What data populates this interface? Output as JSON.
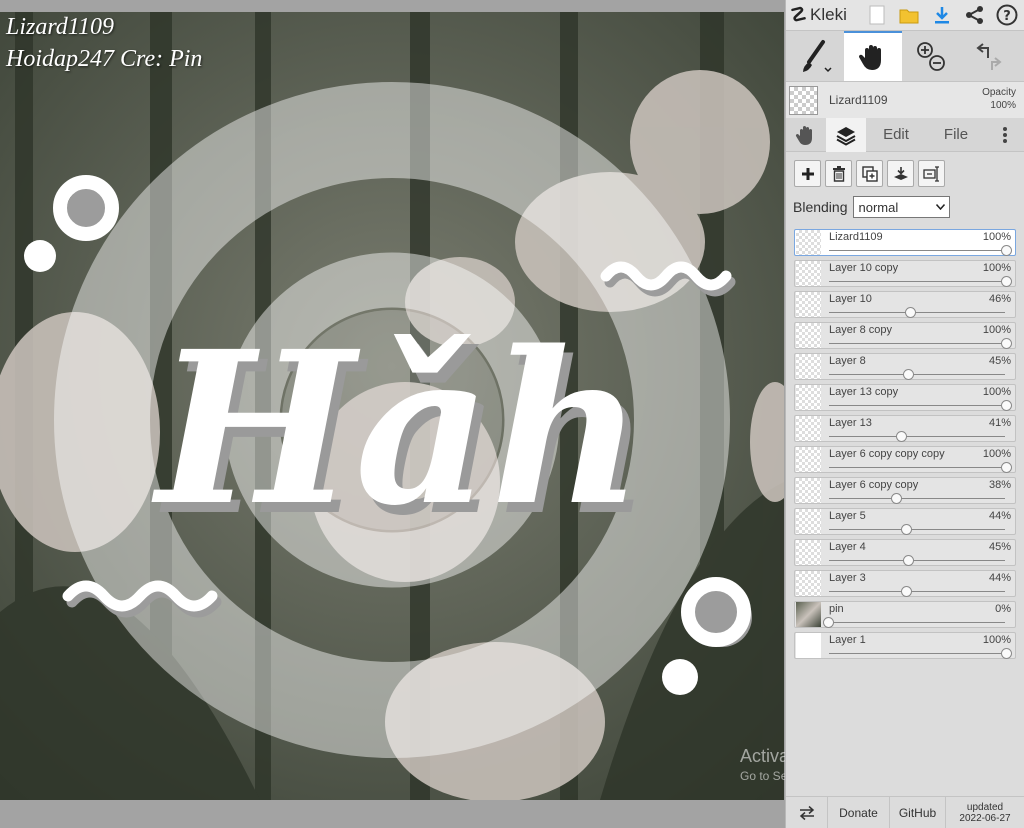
{
  "canvas": {
    "text_line1": "Lizard1109",
    "text_line2": "Hoidap247 Cre: Pin",
    "artwork_word": "Hǎh",
    "watermark_title": "Activate Windows",
    "watermark_sub": "Go to Settings to activate Windows."
  },
  "topbar": {
    "app_name": "Kleki",
    "icons": [
      "new-file-icon",
      "open-folder-icon",
      "download-icon",
      "share-icon",
      "help-icon"
    ]
  },
  "tools": {
    "items": [
      "brush-tool",
      "hand-tool",
      "zoom-tool",
      "undo-redo"
    ],
    "active": "hand-tool"
  },
  "current_layer": {
    "name": "Lizard1109",
    "opacity_label": "Opacity",
    "opacity_value": "100%"
  },
  "tabs": {
    "edit": "Edit",
    "file": "File"
  },
  "layer_panel": {
    "blending_label": "Blending",
    "blending_value": "normal",
    "buttons": [
      "add-layer-icon",
      "delete-layer-icon",
      "duplicate-layer-icon",
      "merge-down-icon",
      "rename-layer-icon"
    ]
  },
  "layers": [
    {
      "name": "Lizard1109",
      "opacity": "100%",
      "value": 1.0,
      "selected": true
    },
    {
      "name": "Layer 10 copy",
      "opacity": "100%",
      "value": 1.0
    },
    {
      "name": "Layer 10",
      "opacity": "46%",
      "value": 0.46
    },
    {
      "name": "Layer 8 copy",
      "opacity": "100%",
      "value": 1.0
    },
    {
      "name": "Layer 8",
      "opacity": "45%",
      "value": 0.45
    },
    {
      "name": "Layer 13 copy",
      "opacity": "100%",
      "value": 1.0
    },
    {
      "name": "Layer 13",
      "opacity": "41%",
      "value": 0.41
    },
    {
      "name": "Layer 6 copy copy copy",
      "opacity": "100%",
      "value": 1.0
    },
    {
      "name": "Layer 6 copy copy",
      "opacity": "38%",
      "value": 0.38
    },
    {
      "name": "Layer 5",
      "opacity": "44%",
      "value": 0.44
    },
    {
      "name": "Layer 4",
      "opacity": "45%",
      "value": 0.45
    },
    {
      "name": "Layer 3",
      "opacity": "44%",
      "value": 0.44
    },
    {
      "name": "pin",
      "opacity": "0%",
      "value": 0.0
    },
    {
      "name": "Layer 1",
      "opacity": "100%",
      "value": 1.0
    }
  ],
  "bottom": {
    "swap_icon": "swap-arrows-icon",
    "donate": "Donate",
    "github": "GitHub",
    "updated_label": "updated",
    "updated_date": "2022-06-27"
  }
}
